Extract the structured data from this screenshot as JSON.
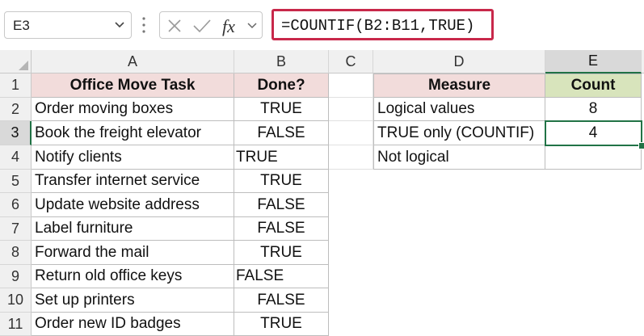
{
  "formula_bar": {
    "name_box": "E3",
    "formula": "=COUNTIF(B2:B11,TRUE)",
    "fx_label": "fx"
  },
  "columns": [
    "A",
    "B",
    "C",
    "D",
    "E"
  ],
  "rows": [
    "1",
    "2",
    "3",
    "4",
    "5",
    "6",
    "7",
    "8",
    "9",
    "10",
    "11"
  ],
  "selected_cell": "E3",
  "task_table": {
    "headers": [
      "Office Move Task",
      "Done?"
    ],
    "rows": [
      {
        "task": "Order moving boxes",
        "done": "TRUE",
        "align": "center"
      },
      {
        "task": "Book the freight elevator",
        "done": "FALSE",
        "align": "center"
      },
      {
        "task": "Notify clients",
        "done": "TRUE",
        "align": "left"
      },
      {
        "task": "Transfer internet service",
        "done": "TRUE",
        "align": "center"
      },
      {
        "task": "Update website address",
        "done": "FALSE",
        "align": "center"
      },
      {
        "task": "Label furniture",
        "done": "FALSE",
        "align": "center"
      },
      {
        "task": "Forward the mail",
        "done": "TRUE",
        "align": "center"
      },
      {
        "task": "Return old office keys",
        "done": "FALSE",
        "align": "left"
      },
      {
        "task": "Set up printers",
        "done": "FALSE",
        "align": "center"
      },
      {
        "task": "Order new ID badges",
        "done": "TRUE",
        "align": "center"
      }
    ]
  },
  "summary_table": {
    "headers": [
      "Measure",
      "Count"
    ],
    "rows": [
      {
        "measure": "Logical values",
        "count": "8"
      },
      {
        "measure": "TRUE only (COUNTIF)",
        "count": "4"
      },
      {
        "measure": "Not logical",
        "count": ""
      }
    ]
  },
  "colors": {
    "header_pink": "#f2dcdb",
    "header_green": "#d8e4bc",
    "formula_highlight": "#c8284a",
    "selection": "#217346"
  }
}
